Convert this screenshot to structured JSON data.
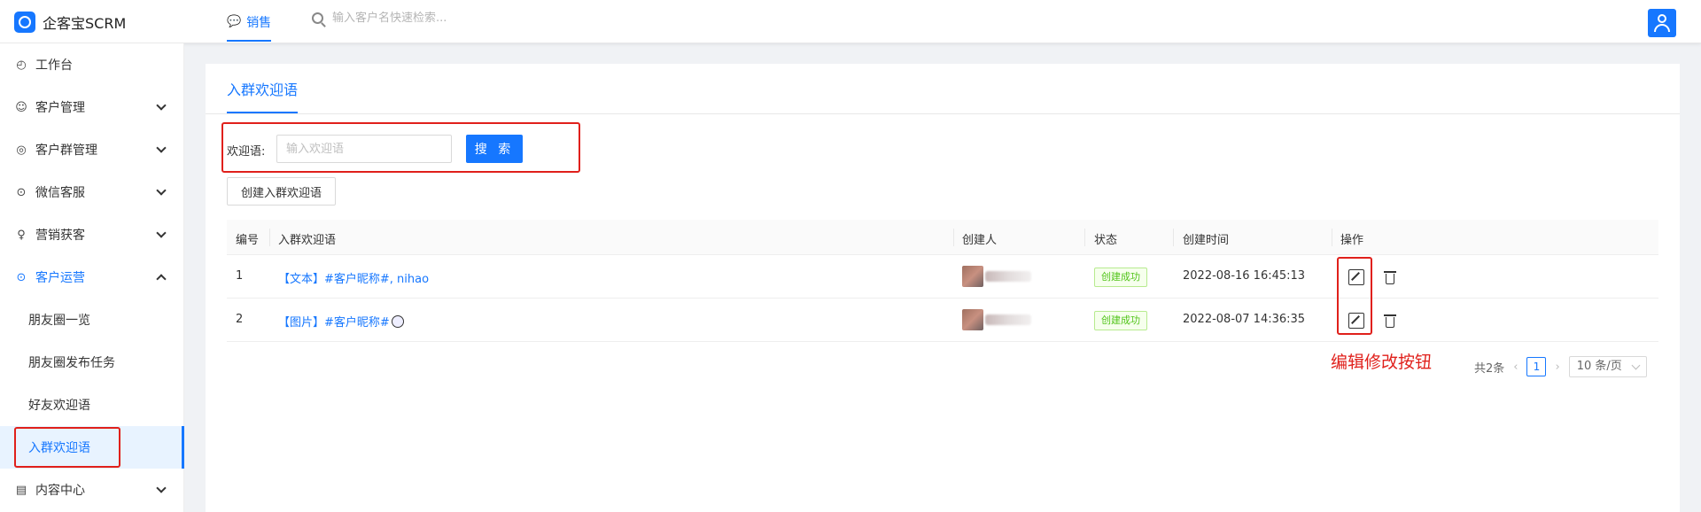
{
  "app": {
    "title": "企客宝SCRM"
  },
  "topbar": {
    "tab_label": "销售",
    "search_placeholder": "输入客户名快速检索..."
  },
  "sidebar": {
    "items": [
      {
        "label": "工作台",
        "icon": "dashboard-icon"
      },
      {
        "label": "客户管理",
        "icon": "users-icon"
      },
      {
        "label": "客户群管理",
        "icon": "chat-icon"
      },
      {
        "label": "微信客服",
        "icon": "service-icon"
      },
      {
        "label": "营销获客",
        "icon": "bulb-icon"
      },
      {
        "label": "客户运营",
        "icon": "ops-icon"
      }
    ],
    "sub_items": [
      {
        "label": "朋友圈一览"
      },
      {
        "label": "朋友圈发布任务"
      },
      {
        "label": "好友欢迎语"
      },
      {
        "label": "入群欢迎语"
      }
    ],
    "bottom_item": {
      "label": "内容中心",
      "icon": "content-icon"
    }
  },
  "page": {
    "tab_label": "入群欢迎语",
    "filter": {
      "label": "欢迎语:",
      "placeholder": "输入欢迎语",
      "search_label": "搜 索"
    },
    "create_label": "创建入群欢迎语"
  },
  "table": {
    "columns": [
      "编号",
      "入群欢迎语",
      "创建人",
      "状态",
      "创建时间",
      "操作"
    ],
    "rows": [
      {
        "id": "1",
        "message": "【文本】#客户昵称#, nihao",
        "status": "创建成功",
        "created": "2022-08-16 16:45:13"
      },
      {
        "id": "2",
        "message": "【图片】#客户昵称#",
        "status": "创建成功",
        "created": "2022-08-07 14:36:35"
      }
    ]
  },
  "pagination": {
    "total": "共2条",
    "current": "1",
    "page_size": "10 条/页"
  },
  "annotation": {
    "label": "编辑修改按钮",
    "color": "#e0201b"
  },
  "colors": {
    "primary": "#1677ff",
    "success": "#52c41a"
  }
}
